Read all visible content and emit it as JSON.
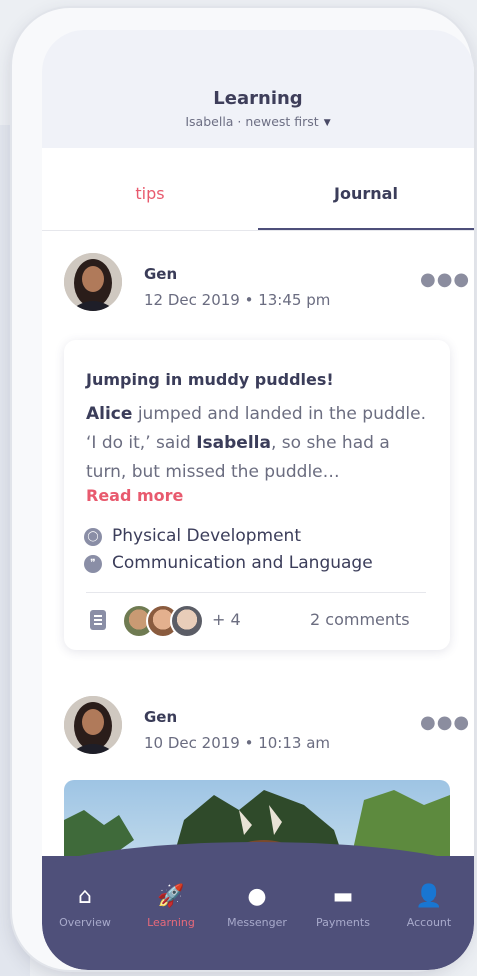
{
  "header": {
    "title": "Learning",
    "subtitle": "Isabella · newest first",
    "caret_icon": "caret-down-icon"
  },
  "tabs": [
    {
      "label": "tips",
      "active": false
    },
    {
      "label": "Journal",
      "active": true
    }
  ],
  "posts": [
    {
      "author": "Gen",
      "date": "12 Dec 2019 • 13:45 pm",
      "card": {
        "title": "Jumping in muddy puddles!",
        "text_name1": "Alice",
        "text_mid": " jumped and landed in the puddle. ‘I do it,’ said ",
        "text_name2": "Isabella",
        "text_end": ", so she had a turn, but missed the puddle…",
        "read_more": "Read more",
        "areas": [
          "Physical Development",
          "Communication and Language"
        ],
        "extra_children": "+ 4",
        "comments": "2 comments"
      }
    },
    {
      "author": "Gen",
      "date": "10 Dec 2019 • 10:13 am"
    }
  ],
  "nav": [
    {
      "label": "Overview",
      "icon": "home-icon",
      "active": false
    },
    {
      "label": "Learning",
      "icon": "rocket-icon",
      "active": true
    },
    {
      "label": "Messenger",
      "icon": "chat-bubble-icon",
      "active": false
    },
    {
      "label": "Payments",
      "icon": "credit-card-icon",
      "active": false
    },
    {
      "label": "Account",
      "icon": "person-icon",
      "active": false
    }
  ],
  "colors": {
    "accent": "#e85a6e",
    "nav_background": "#4f507a",
    "text_dark": "#3b3d5a"
  }
}
